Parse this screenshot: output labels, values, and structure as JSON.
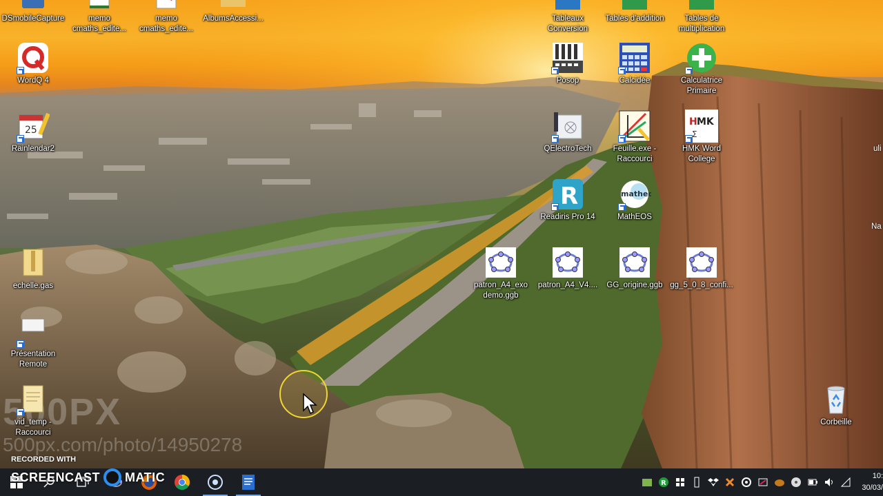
{
  "desktop": {
    "icons": [
      {
        "label": "DSmobileCapture"
      },
      {
        "label": "memo cmaths_edite..."
      },
      {
        "label": "memo cmaths_edite..."
      },
      {
        "label": "AlbumsAccessi..."
      },
      {
        "label": "WordQ 4"
      },
      {
        "label": "Rainlendar2"
      },
      {
        "label": "echelle.gas"
      },
      {
        "label": "Présentation Remote"
      },
      {
        "label": "vid_temp - Raccourci"
      },
      {
        "label": "Tableaux Conversion"
      },
      {
        "label": "Tables d'addition"
      },
      {
        "label": "Tables de multiplication"
      },
      {
        "label": "Posop"
      },
      {
        "label": "Calcidée"
      },
      {
        "label": "Calculatrice Primaire"
      },
      {
        "label": "QElectroTech"
      },
      {
        "label": "Feuille.exe - Raccourci"
      },
      {
        "label": "HMK Word College"
      },
      {
        "label": "Readiris Pro 14"
      },
      {
        "label": "MathEOS"
      },
      {
        "label": "patron_A4_exo demo.ggb"
      },
      {
        "label": "patron_A4_V4...."
      },
      {
        "label": "GG_origine.ggb"
      },
      {
        "label": "gg_5_0_8_confi..."
      },
      {
        "label": "Corbeille"
      },
      {
        "label": "uli"
      },
      {
        "label": "Na"
      }
    ],
    "watermark_big": "500PX",
    "watermark_url": "500px.com/photo/14950278"
  },
  "recording": {
    "recorded_with": "RECORDED WITH",
    "brand_left": "SCREENCAST",
    "brand_right": "MATIC"
  },
  "taskbar": {
    "apps": [
      "start-icon",
      "search-icon",
      "task-view-icon",
      "geogebra-icon",
      "firefox-icon",
      "chrome-icon",
      "screencast-icon",
      "document-icon"
    ],
    "tray_icons": [
      "geany-icon",
      "r-icon",
      "shield-icon",
      "usb-icon",
      "dropbox-icon",
      "puzzle-icon",
      "settings-icon",
      "tablet-icon",
      "app-icon",
      "wifi-disc-icon",
      "battery-icon",
      "volume-icon",
      "network-icon"
    ],
    "clock_time": "10:",
    "clock_date": "30/03/"
  }
}
